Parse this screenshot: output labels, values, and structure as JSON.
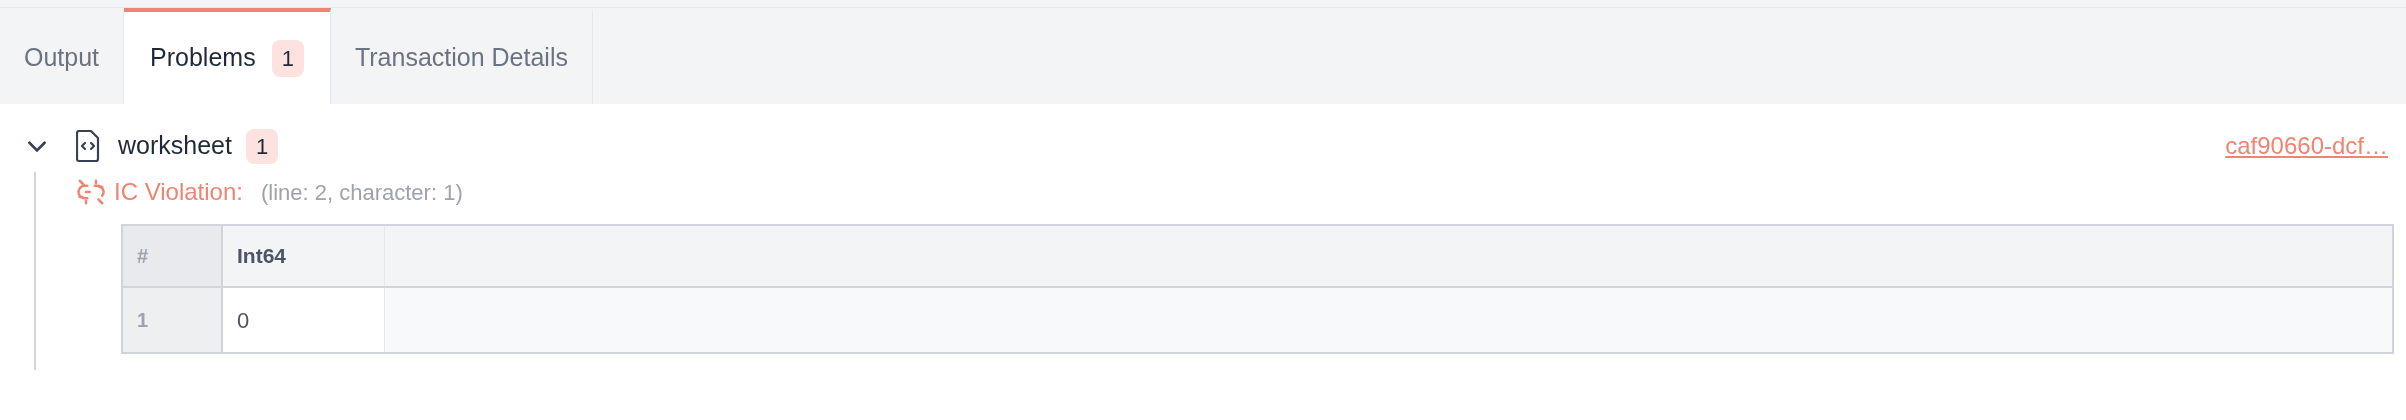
{
  "tabs": [
    {
      "label": "Output",
      "selected": false
    },
    {
      "label": "Problems",
      "selected": true,
      "badge": "1"
    },
    {
      "label": "Transaction Details",
      "selected": false
    }
  ],
  "problems": [
    {
      "file": "worksheet",
      "expanded": true,
      "count": "1",
      "link": "caf90660-dcf…",
      "issues": [
        {
          "title": "IC Violation:",
          "location": "(line: 2, character: 1)",
          "table": {
            "columns": [
              "#",
              "Int64"
            ],
            "rows": [
              [
                "1",
                "0"
              ]
            ]
          }
        }
      ]
    }
  ]
}
